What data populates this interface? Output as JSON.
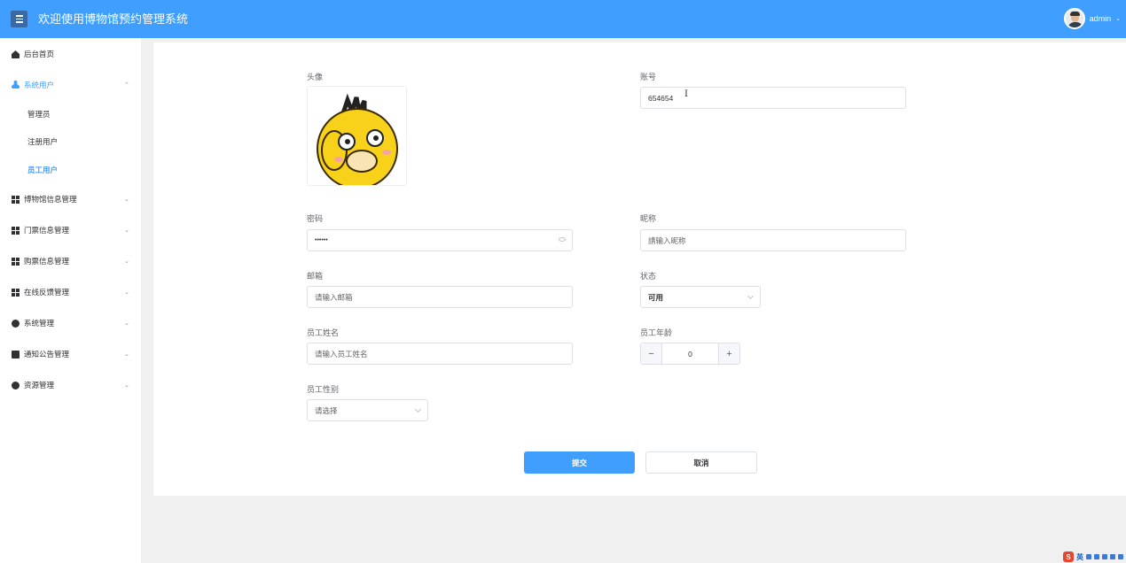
{
  "header": {
    "title": "欢迎使用博物馆预约管理系统",
    "username": "admin",
    "caret": "⌄"
  },
  "sidebar": {
    "items": [
      {
        "label": "后台首页",
        "icon": "home-icon"
      },
      {
        "label": "系统用户",
        "icon": "user-icon",
        "expanded": true,
        "children": [
          "管理员",
          "注册用户",
          "员工用户"
        ],
        "active_child": "员工用户"
      },
      {
        "label": "博物馆信息管理",
        "icon": "grid-icon"
      },
      {
        "label": "门票信息管理",
        "icon": "grid-icon"
      },
      {
        "label": "购票信息管理",
        "icon": "grid-icon"
      },
      {
        "label": "在线反馈管理",
        "icon": "grid-icon"
      },
      {
        "label": "系统管理",
        "icon": "gear-icon"
      },
      {
        "label": "通知公告管理",
        "icon": "document-icon"
      },
      {
        "label": "资源管理",
        "icon": "plus-circle-icon"
      }
    ],
    "arrow_down": "⌄",
    "arrow_up": "⌃"
  },
  "form": {
    "avatar_label": "头像",
    "account_label": "账号",
    "account_value": "654654",
    "password_label": "密码",
    "password_value": "••••••",
    "nickname_label": "昵称",
    "nickname_placeholder": "請输入昵称",
    "email_label": "邮箱",
    "email_placeholder": "请输入邮箱",
    "status_label": "状态",
    "status_value": "可用",
    "staff_name_label": "员工姓名",
    "staff_name_placeholder": "请输入员工姓名",
    "staff_age_label": "员工年龄",
    "staff_age_value": "0",
    "staff_gender_label": "员工性别",
    "staff_gender_placeholder": "请选择",
    "submit_label": "提交",
    "cancel_label": "取消"
  },
  "ime": {
    "logo": "S",
    "mode": "英"
  },
  "colors": {
    "primary": "#409eff",
    "header_bg": "#409eff",
    "page_bg": "#f0f0f0"
  }
}
